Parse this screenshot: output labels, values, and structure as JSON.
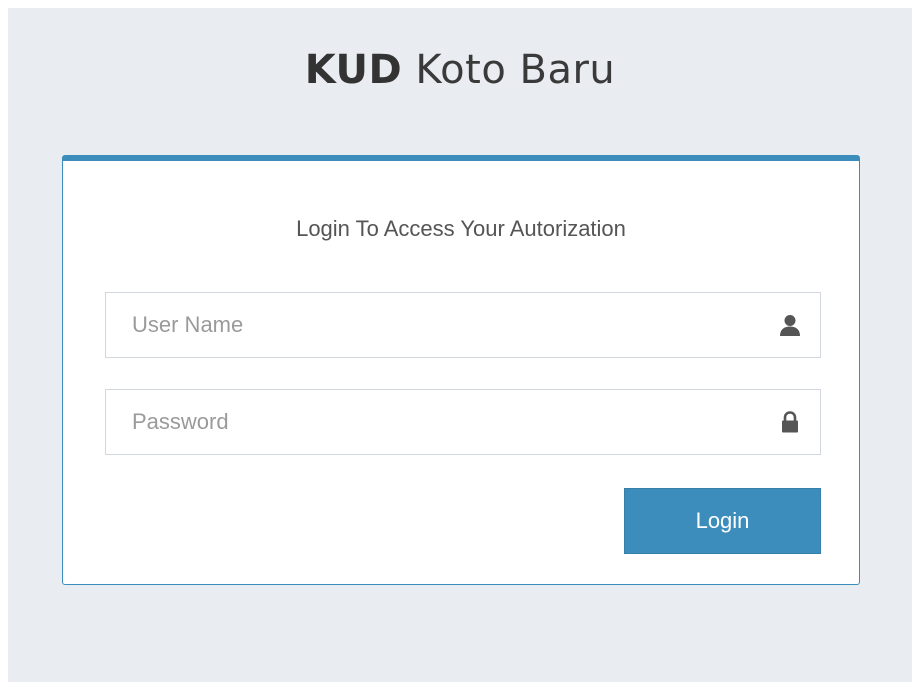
{
  "logo": {
    "strong": "KUD",
    "light": "Koto Baru"
  },
  "login": {
    "message": "Login To Access Your Autorization",
    "username": {
      "value": "",
      "placeholder": "User Name",
      "icon": "user-icon"
    },
    "password": {
      "value": "",
      "placeholder": "Password",
      "icon": "lock-icon"
    },
    "submit_label": "Login"
  },
  "colors": {
    "page_background": "#e9edf2",
    "accent": "#3c8dbc",
    "icon": "#555555"
  }
}
